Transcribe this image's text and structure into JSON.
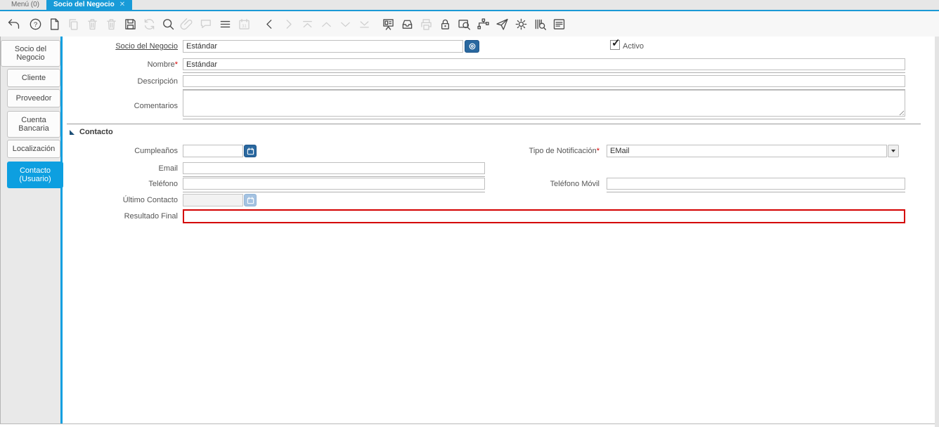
{
  "header": {
    "tabs": [
      {
        "label": "Menú (0)",
        "active": false
      },
      {
        "label": "Socio del Negocio",
        "active": true,
        "close_icon": "✕"
      }
    ]
  },
  "toolbar": {
    "items": [
      {
        "icon": "undo-icon",
        "enabled": true
      },
      {
        "icon": "help-icon",
        "enabled": true
      },
      {
        "icon": "new-record-icon",
        "enabled": true
      },
      {
        "icon": "copy-record-icon",
        "enabled": false
      },
      {
        "icon": "delete-record-icon",
        "enabled": false
      },
      {
        "icon": "delete-selection-icon",
        "enabled": false
      },
      {
        "icon": "save-icon",
        "enabled": true
      },
      {
        "icon": "refresh-icon",
        "enabled": false
      },
      {
        "icon": "find-icon",
        "enabled": true
      },
      {
        "icon": "attachment-icon",
        "enabled": false
      },
      {
        "icon": "chat-icon",
        "enabled": false
      },
      {
        "icon": "grid-toggle-icon",
        "enabled": true
      },
      {
        "icon": "calendar-icon",
        "enabled": false
      },
      {
        "icon": "previous-record-icon",
        "enabled": true
      },
      {
        "icon": "next-record-icon",
        "enabled": false
      },
      {
        "icon": "first-record-icon",
        "enabled": false
      },
      {
        "icon": "parent-record-icon",
        "enabled": false
      },
      {
        "icon": "detail-record-icon",
        "enabled": false
      },
      {
        "icon": "last-record-icon",
        "enabled": false
      },
      {
        "icon": "report-icon",
        "enabled": true
      },
      {
        "icon": "archive-icon",
        "enabled": true
      },
      {
        "icon": "print-icon",
        "enabled": false
      },
      {
        "icon": "lock-icon",
        "enabled": true
      },
      {
        "icon": "zoom-across-icon",
        "enabled": true
      },
      {
        "icon": "workflow-icon",
        "enabled": true
      },
      {
        "icon": "send-mail-icon",
        "enabled": true
      },
      {
        "icon": "preferences-icon",
        "enabled": true
      },
      {
        "icon": "product-info-icon",
        "enabled": true
      },
      {
        "icon": "window-report-icon",
        "enabled": true
      }
    ]
  },
  "sidebar": {
    "tabs": [
      {
        "label": "Socio del Negocio",
        "active": false
      },
      {
        "label": "Cliente",
        "active": false
      },
      {
        "label": "Proveedor",
        "active": false
      },
      {
        "label": "Cuenta Bancaria",
        "active": false
      },
      {
        "label": "Localización",
        "active": false
      },
      {
        "label": "Contacto (Usuario)",
        "active": true
      }
    ]
  },
  "form": {
    "bpartner": {
      "label": "Socio del Negocio",
      "value": "Estándar"
    },
    "active": {
      "label": "Activo",
      "checked": true,
      "check_glyph": "✓"
    },
    "name": {
      "label": "Nombre",
      "required_mark": "*",
      "value": "Estándar"
    },
    "description": {
      "label": "Descripción",
      "value": ""
    },
    "comments": {
      "label": "Comentarios",
      "value": ""
    },
    "contact_section": {
      "title": "Contacto"
    },
    "birthday": {
      "label": "Cumpleaños",
      "value": ""
    },
    "notification_type": {
      "label": "Tipo de Notificación",
      "required_mark": "*",
      "value": "EMail"
    },
    "email": {
      "label": "Email",
      "value": ""
    },
    "phone": {
      "label": "Teléfono",
      "value": ""
    },
    "mobile": {
      "label": "Teléfono Móvil",
      "value": ""
    },
    "last_contact": {
      "label": "Último Contacto",
      "value": "",
      "disabled": true
    },
    "last_result": {
      "label": "Resultado Final",
      "value": "",
      "error": true
    }
  },
  "colors": {
    "accent_blue": "#189bd8",
    "sidebar_active_blue": "#0d9fe0",
    "button_blue": "#2a689f",
    "error_red": "#d40000"
  }
}
